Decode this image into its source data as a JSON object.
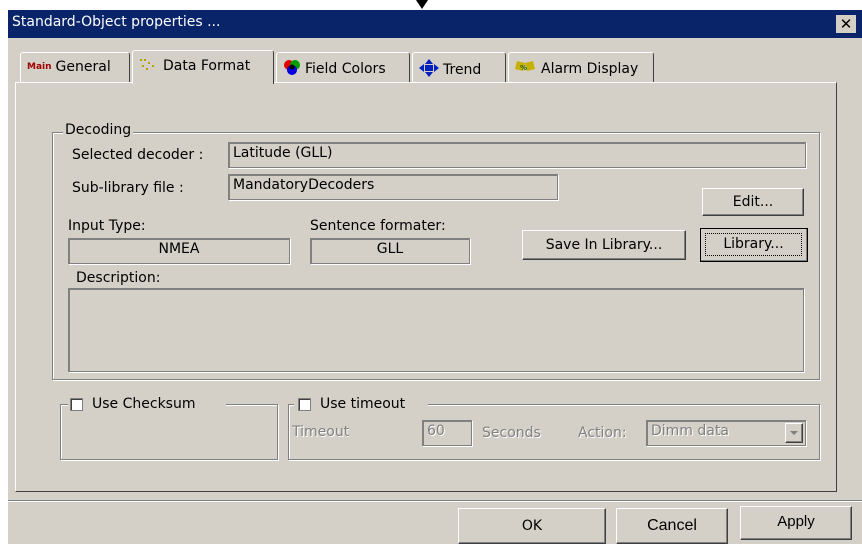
{
  "window": {
    "title": "Standard-Object properties ...",
    "close_glyph": "✕"
  },
  "tabs": [
    {
      "label": "General",
      "icon": "main-icon",
      "icon_text": "Main"
    },
    {
      "label": "Data Format",
      "icon": "data-format-icon"
    },
    {
      "label": "Field Colors",
      "icon": "field-colors-icon"
    },
    {
      "label": "Trend",
      "icon": "trend-arrows-icon"
    },
    {
      "label": "Alarm Display",
      "icon": "alarm-display-icon"
    }
  ],
  "decoding": {
    "legend": "Decoding",
    "selected_decoder_label": "Selected decoder :",
    "selected_decoder_value": "Latitude (GLL)",
    "sublibrary_label": "Sub-library file :",
    "sublibrary_value": "MandatoryDecoders",
    "input_type_label": "Input Type:",
    "input_type_value": "NMEA",
    "sentence_formatter_label": "Sentence formater:",
    "sentence_formatter_value": "GLL",
    "description_label": "Description:",
    "description_value": "",
    "edit_button": "Edit...",
    "save_in_library_button": "Save In Library...",
    "library_button": "Library..."
  },
  "checksum": {
    "label": "Use Checksum",
    "checked": false
  },
  "timeout": {
    "label": "Use timeout",
    "checked": false,
    "timeout_label": "Timeout",
    "timeout_value": "60",
    "seconds_label": "Seconds",
    "action_label": "Action:",
    "action_value": "Dimm data"
  },
  "footer": {
    "ok": "OK",
    "cancel": "Cancel",
    "apply": "Apply"
  }
}
